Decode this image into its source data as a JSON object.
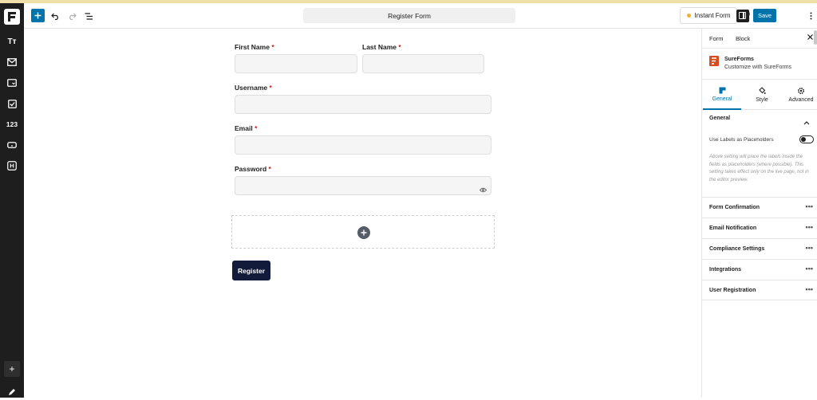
{
  "topbar": {
    "title": "Register Form",
    "instant_form_label": "Instant Form",
    "save_label": "Save"
  },
  "leftbar": {
    "items": [
      {
        "icon": "text-icon",
        "glyph": "Tт"
      },
      {
        "icon": "mail-icon"
      },
      {
        "icon": "dropdown-icon"
      },
      {
        "icon": "checkbox-icon"
      },
      {
        "icon": "number-icon",
        "glyph": "123"
      },
      {
        "icon": "button-icon"
      },
      {
        "icon": "heading-icon",
        "glyph": "H"
      }
    ],
    "bottom_add": "+"
  },
  "form": {
    "first_name_label": "First Name",
    "last_name_label": "Last Name",
    "username_label": "Username",
    "email_label": "Email",
    "password_label": "Password",
    "required_mark": "*",
    "submit_label": "Register"
  },
  "sidebar": {
    "tabs": [
      "Form",
      "Block"
    ],
    "plugin_name": "SureForms",
    "plugin_desc": "Customize with SureForms",
    "subtabs": [
      "General",
      "Style",
      "Advanced"
    ],
    "section_title": "General",
    "toggle_label": "Use Labels as Placeholders",
    "help_text": "Above setting will place the labels inside the fields as placeholders (where possible). This setting takes effect only on the live page, not in the editor preview.",
    "rows": [
      "Form Confirmation",
      "Email Notification",
      "Compliance Settings",
      "Integrations",
      "User Registration"
    ],
    "more_glyph": "•••"
  },
  "colors": {
    "accent": "#0073aa",
    "brand": "#d64d1f",
    "submit_bg": "#121c3a",
    "required": "#cc1818"
  }
}
